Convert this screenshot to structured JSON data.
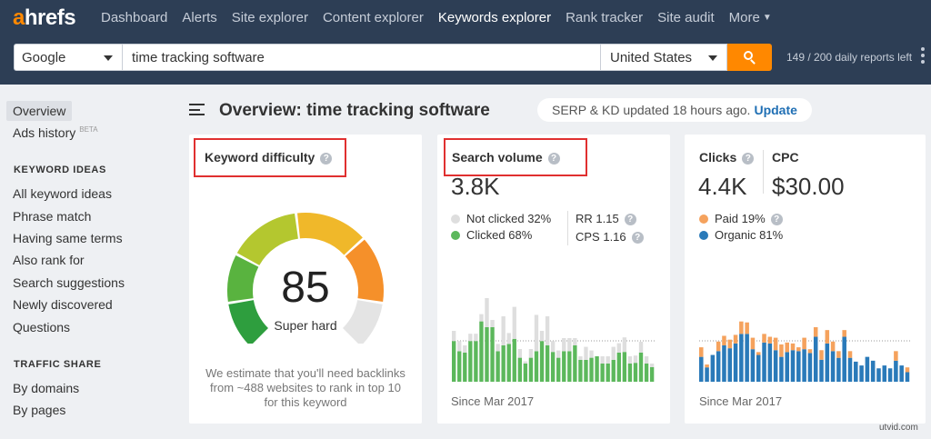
{
  "brand": {
    "logo_a": "a",
    "logo_rest": "hrefs",
    "accent": "#ff8800"
  },
  "nav": {
    "items": [
      "Dashboard",
      "Alerts",
      "Site explorer",
      "Content explorer",
      "Keywords explorer",
      "Rank tracker",
      "Site audit"
    ],
    "more": "More",
    "active_index": 4
  },
  "search": {
    "engine": "Google",
    "query": "time tracking software",
    "country": "United States",
    "reports": "149 / 200 daily reports left"
  },
  "sidebar": {
    "overview": "Overview",
    "ads_history": "Ads history",
    "beta": "BETA",
    "keyword_ideas_head": "KEYWORD IDEAS",
    "keyword_ideas": [
      "All keyword ideas",
      "Phrase match",
      "Having same terms",
      "Also rank for",
      "Search suggestions",
      "Newly discovered",
      "Questions"
    ],
    "traffic_head": "TRAFFIC SHARE",
    "traffic": [
      "By domains",
      "By pages"
    ]
  },
  "header": {
    "title": "Overview: time tracking software",
    "updated": "SERP & KD updated 18 hours ago.",
    "update_link": "Update"
  },
  "kd_card": {
    "title": "Keyword difficulty",
    "value": "85",
    "label": "Super hard",
    "description": "We estimate that you'll need backlinks from ~488 websites to rank in top 10 for this keyword"
  },
  "sv_card": {
    "title": "Search volume",
    "value": "3.8K",
    "not_clicked": "Not clicked 32%",
    "clicked": "Clicked 68%",
    "rr": "RR 1.15",
    "cps": "CPS 1.16",
    "since": "Since Mar 2017"
  },
  "clicks_card": {
    "clicks_title": "Clicks",
    "cpc_title": "CPC",
    "clicks_value": "4.4K",
    "cpc_value": "$30.00",
    "paid": "Paid 19%",
    "organic": "Organic 81%",
    "since": "Since Mar 2017"
  },
  "colors": {
    "not_clicked": "#dedede",
    "clicked": "#5cb85c",
    "paid": "#f5a25d",
    "organic": "#2a7ab9",
    "highlight": "#e03030"
  },
  "chart_data": [
    {
      "type": "bar",
      "title": "Search volume",
      "series": [
        {
          "name": "Clicked",
          "values": [
            56,
            42,
            40,
            56,
            56,
            83,
            75,
            75,
            42,
            50,
            52,
            59,
            33,
            25,
            33,
            42,
            56,
            50,
            41,
            33,
            42,
            42,
            50,
            30,
            30,
            33,
            35,
            25,
            25,
            30,
            40,
            41,
            25,
            26,
            40,
            25,
            20
          ]
        },
        {
          "name": "Not clicked",
          "values": [
            14,
            14,
            10,
            10,
            10,
            10,
            40,
            10,
            10,
            40,
            15,
            44,
            12,
            3,
            12,
            50,
            14,
            40,
            15,
            10,
            18,
            18,
            10,
            5,
            18,
            10,
            0,
            10,
            10,
            18,
            13,
            20,
            10,
            10,
            15,
            10,
            5
          ]
        }
      ]
    },
    {
      "type": "bar",
      "title": "Clicks",
      "series": [
        {
          "name": "Organic",
          "values": [
            26,
            15,
            28,
            32,
            38,
            35,
            40,
            50,
            50,
            34,
            28,
            41,
            40,
            33,
            26,
            31,
            33,
            32,
            34,
            30,
            47,
            23,
            40,
            32,
            25,
            47,
            25,
            21,
            17,
            26,
            22,
            14,
            17,
            14,
            22,
            17,
            10
          ]
        },
        {
          "name": "Paid",
          "values": [
            10,
            3,
            0,
            10,
            10,
            9,
            9,
            13,
            12,
            12,
            3,
            9,
            7,
            13,
            13,
            10,
            7,
            4,
            12,
            4,
            10,
            10,
            14,
            10,
            7,
            7,
            7,
            0,
            0,
            0,
            0,
            0,
            0,
            0,
            10,
            0,
            5
          ]
        }
      ]
    }
  ]
}
